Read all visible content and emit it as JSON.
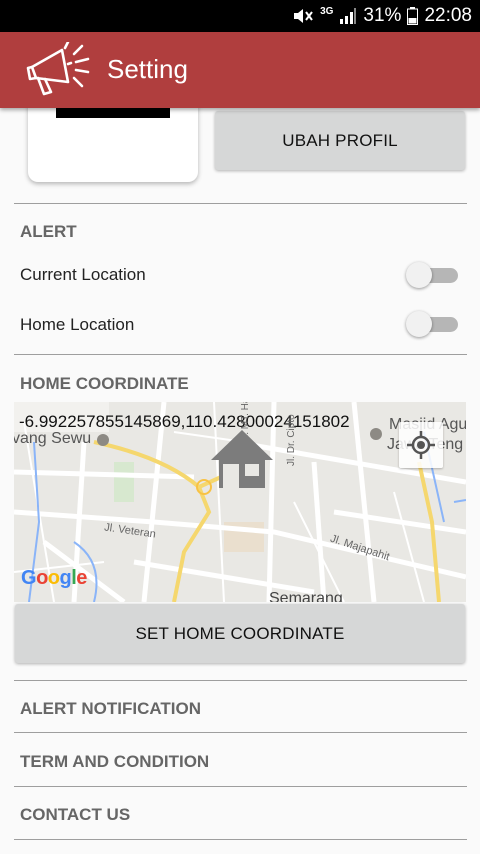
{
  "status_bar": {
    "battery": "31%",
    "time": "22:08",
    "network": "3G"
  },
  "app_bar": {
    "title": "Setting",
    "logo_icon": "megaphone-icon"
  },
  "profile": {
    "edit_button_label": "UBAH PROFIL"
  },
  "alert": {
    "heading": "ALERT",
    "current_location_label": "Current Location",
    "current_location_on": false,
    "home_location_label": "Home Location",
    "home_location_on": false
  },
  "home_coordinate": {
    "heading": "HOME COORDINATE",
    "coordinate_text": "-6.992257855145869,110.42800024151802",
    "map_labels": {
      "place_lawang_sewu": "vang Sewu",
      "place_masjid": "Masjid Agu",
      "place_masjid_2": "Jawa Teng",
      "street_veteran": "Jl. Veteran",
      "street_majapahit": "Jl. Majapahit",
      "street_haryono": "Jl. MT. Haryono",
      "street_dr_cipto": "Jl. Dr. Cipto",
      "city": "Semarang",
      "google": "Google"
    },
    "set_button_label": "SET HOME COORDINATE"
  },
  "menu": {
    "alert_notification": "ALERT NOTIFICATION",
    "term_and_condition": "TERM AND CONDITION",
    "contact_us": "CONTACT US"
  },
  "colors": {
    "app_bar": "#b03e3e",
    "button_bg": "#d6d7d7",
    "section_text": "#666666",
    "toggle_track_off": "#b6b6b6"
  }
}
